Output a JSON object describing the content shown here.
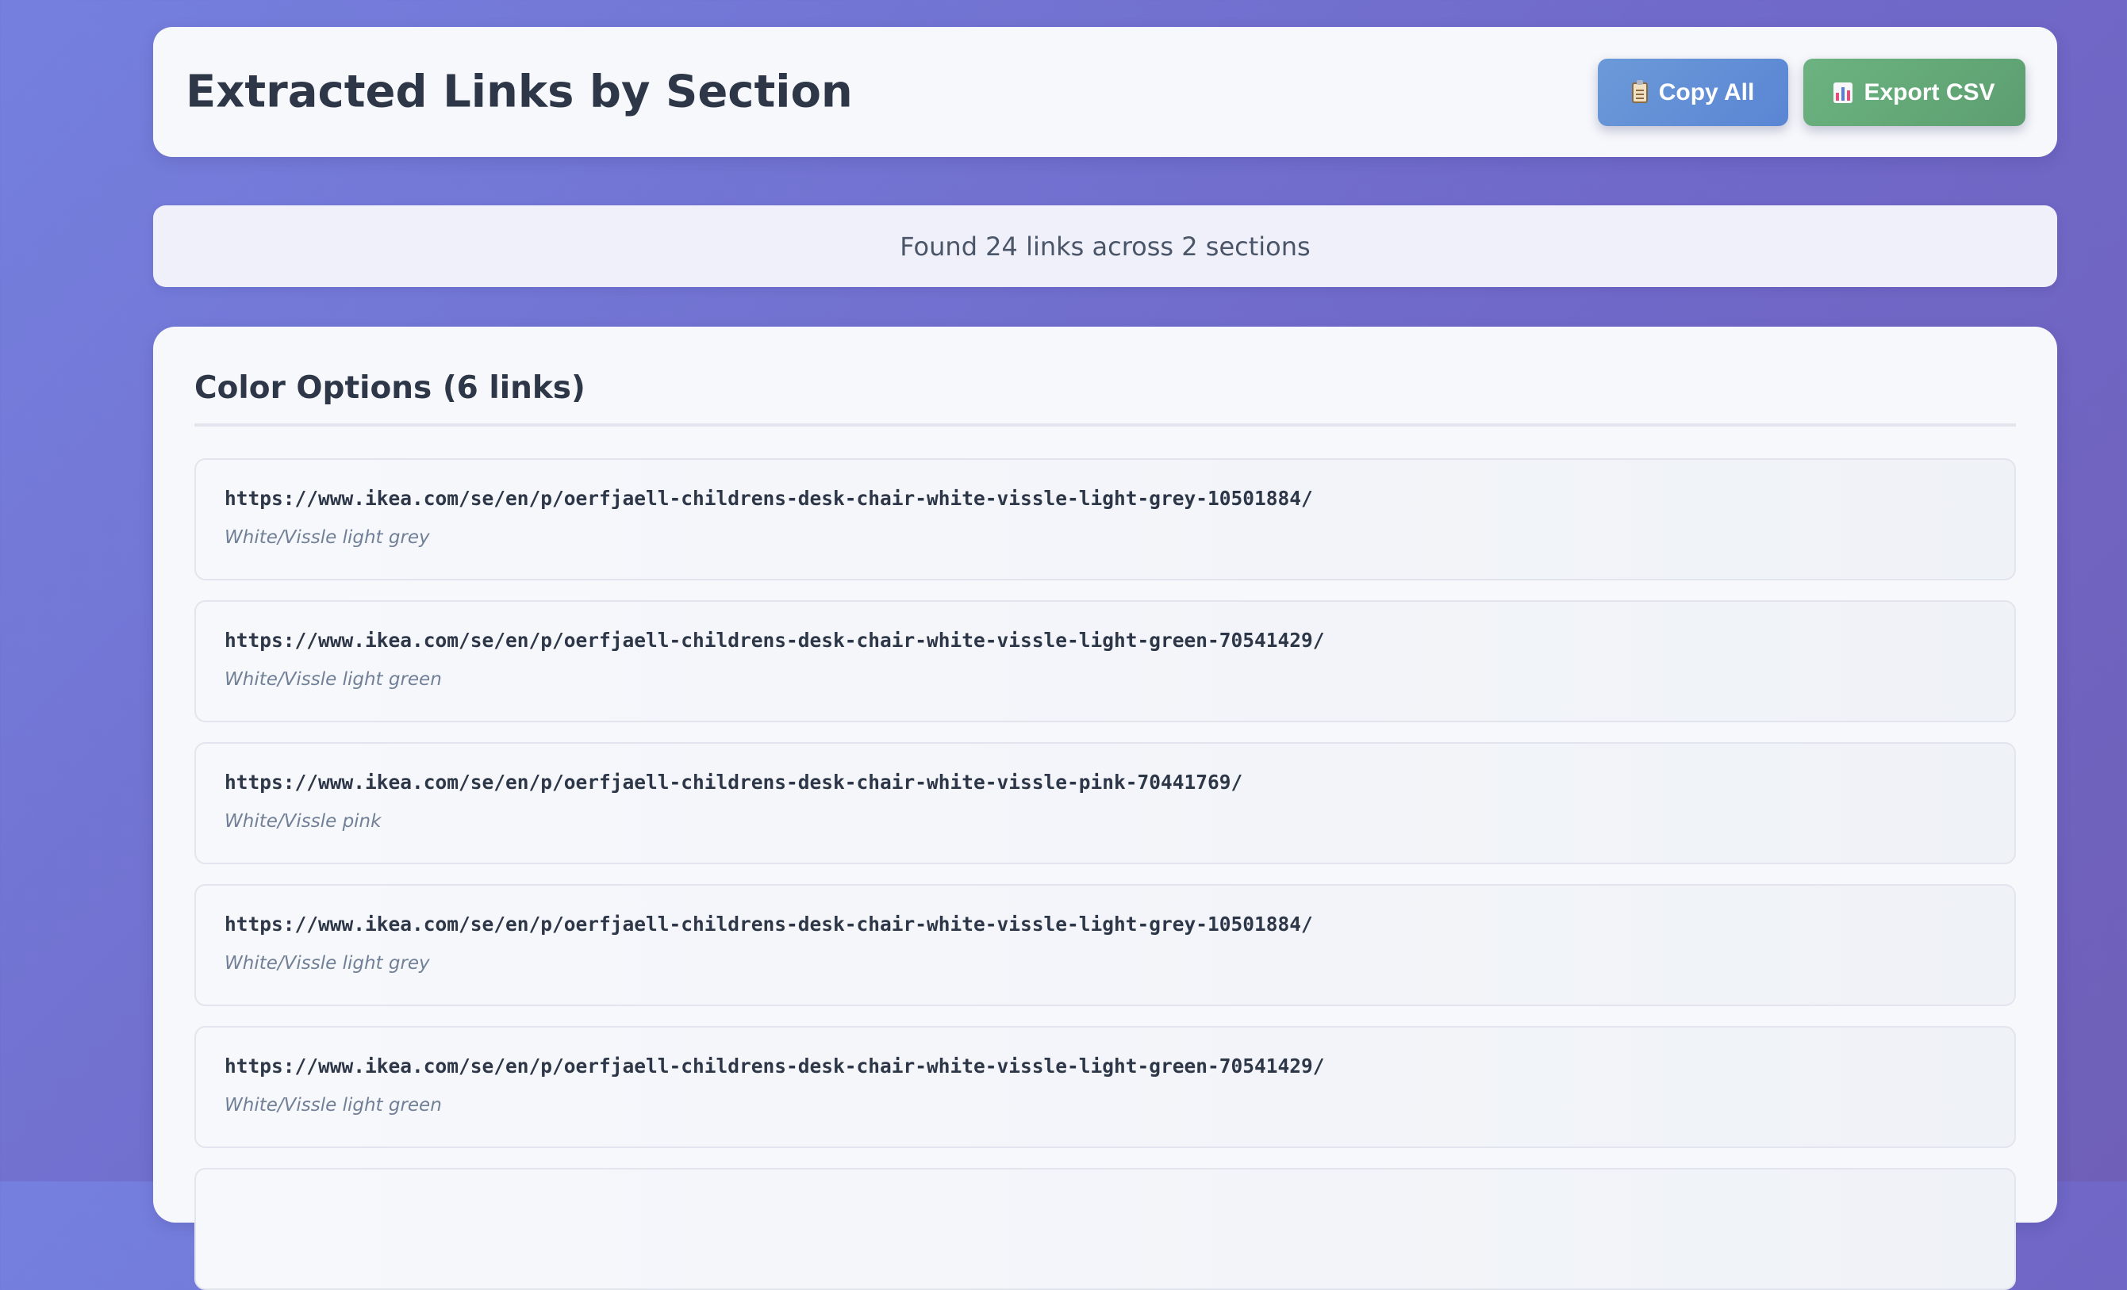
{
  "header": {
    "title": "Extracted Links by Section",
    "copy_all_label": "Copy All",
    "export_csv_label": "Export CSV"
  },
  "summary": {
    "text": "Found 24 links across 2 sections"
  },
  "section": {
    "title": "Color Options (6 links)",
    "links": [
      {
        "url": "https://www.ikea.com/se/en/p/oerfjaell-childrens-desk-chair-white-vissle-light-grey-10501884/",
        "label": "White/Vissle light grey"
      },
      {
        "url": "https://www.ikea.com/se/en/p/oerfjaell-childrens-desk-chair-white-vissle-light-green-70541429/",
        "label": "White/Vissle light green"
      },
      {
        "url": "https://www.ikea.com/se/en/p/oerfjaell-childrens-desk-chair-white-vissle-pink-70441769/",
        "label": "White/Vissle pink"
      },
      {
        "url": "https://www.ikea.com/se/en/p/oerfjaell-childrens-desk-chair-white-vissle-light-grey-10501884/",
        "label": "White/Vissle light grey"
      },
      {
        "url": "https://www.ikea.com/se/en/p/oerfjaell-childrens-desk-chair-white-vissle-light-green-70541429/",
        "label": "White/Vissle light green"
      }
    ]
  },
  "icons": {
    "copy": "clipboard-icon",
    "export": "bar-chart-icon"
  },
  "colors": {
    "background_start": "#7580de",
    "background_end": "#6f5fb8",
    "copy_button": "#5a85d4",
    "export_button": "#5d9e70",
    "card": "#f7f8fc",
    "text": "#2d3748",
    "muted": "#718096"
  }
}
